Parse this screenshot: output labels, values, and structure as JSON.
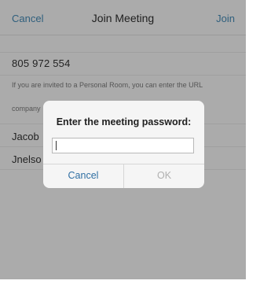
{
  "header": {
    "cancel_label": "Cancel",
    "title": "Join Meeting",
    "join_label": "Join"
  },
  "form": {
    "meeting_number": "805 972 554",
    "personal_room_hint": "If you are invited to a Personal Room, you can enter the URL",
    "personal_room_hint_line2": "company",
    "name_value": "Jacob",
    "email_value": "Jnelso"
  },
  "dialog": {
    "title": "Enter the meeting password:",
    "password_value": "",
    "cancel_label": "Cancel",
    "ok_label": "OK"
  },
  "colors": {
    "accent": "#2f6fa3",
    "disabled": "#b0b0b0"
  }
}
